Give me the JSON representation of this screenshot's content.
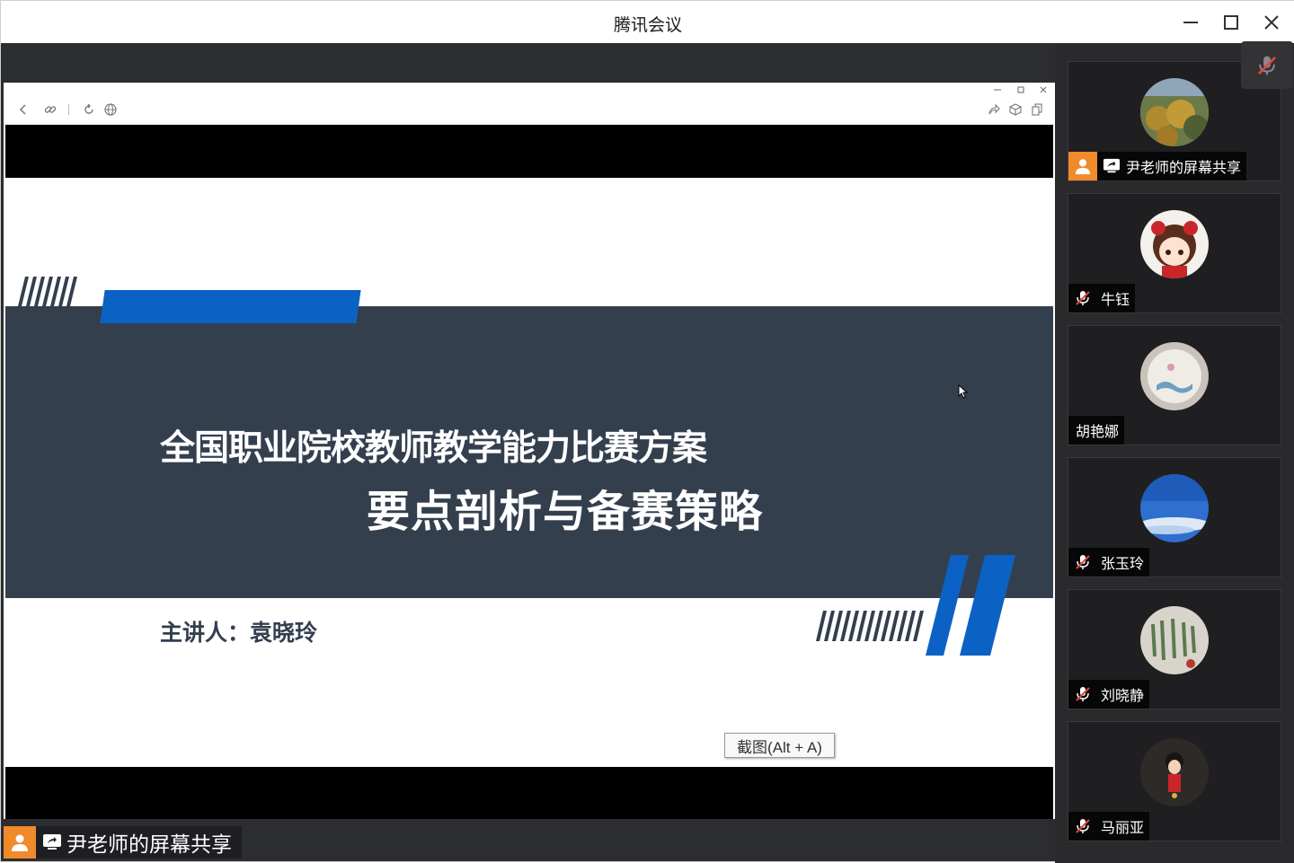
{
  "window": {
    "title": "腾讯会议"
  },
  "slide": {
    "title_line1": "全国职业院校教师教学能力比赛方案",
    "title_line2": "要点剖析与备赛策略",
    "presenter": "主讲人：袁晓玲"
  },
  "tooltip": {
    "text": "截图(Alt + A)"
  },
  "main_share_label": "尹老师的屏幕共享",
  "participants": [
    {
      "name": "尹老师的屏幕共享",
      "status": "sharing"
    },
    {
      "name": "牛钰",
      "status": "muted"
    },
    {
      "name": "胡艳娜",
      "status": "none"
    },
    {
      "name": "张玉玲",
      "status": "muted"
    },
    {
      "name": "刘晓静",
      "status": "muted"
    },
    {
      "name": "马丽亚",
      "status": "muted"
    }
  ],
  "colors": {
    "slide_band": "#343f4e",
    "slide_accent": "#0b62c4",
    "host_badge": "#f08a2a"
  },
  "icons": [
    "minimize-icon",
    "maximize-icon",
    "close-icon",
    "back-icon",
    "link-icon",
    "refresh-icon",
    "globe-icon",
    "share-arrow-icon",
    "cube-icon",
    "pages-icon",
    "mic-off-icon",
    "screen-share-icon",
    "user-icon"
  ]
}
